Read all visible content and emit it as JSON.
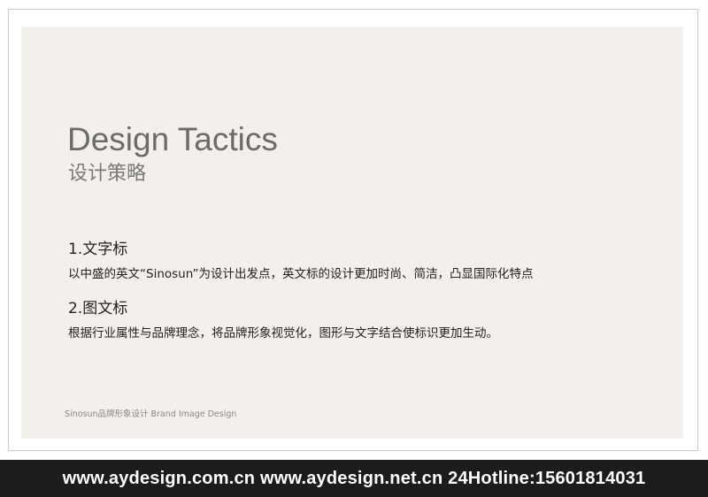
{
  "slide": {
    "title_en": "Design Tactics",
    "title_cn": "设计策略",
    "sections": [
      {
        "heading": "1.文字标",
        "body": "以中盛的英文“Sinosun”为设计出发点，英文标的设计更加时尚、简洁，凸显国际化特点"
      },
      {
        "heading": "2.图文标",
        "body": "根据行业属性与品牌理念，将品牌形象视觉化，图形与文字结合使标识更加生动。"
      }
    ],
    "footer_note": "Sinosun品牌形象设计  Brand Image Design"
  },
  "banner": {
    "text": "www.aydesign.com.cn www.aydesign.net.cn 24Hotline:15601814031"
  },
  "colors": {
    "panel_bg": "#f3efea",
    "title": "#6b6b6b",
    "banner_bg": "#1c1c1c",
    "banner_text": "#ffffff"
  }
}
